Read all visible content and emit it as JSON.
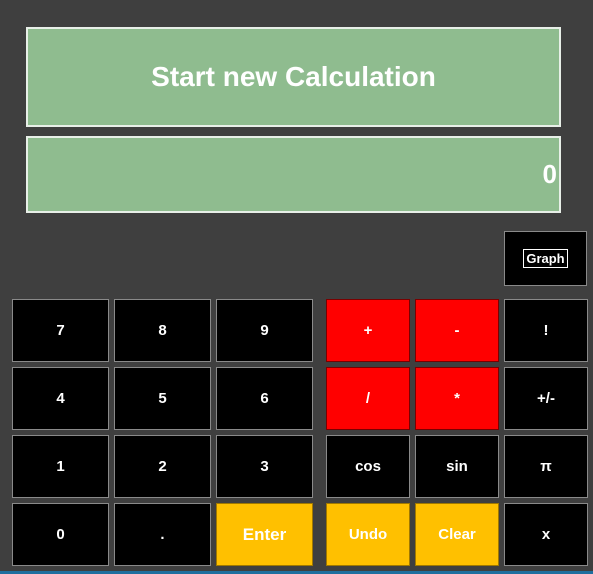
{
  "title": "Start new Calculation",
  "display_value": "0",
  "graph_button": {
    "label": "Graph"
  },
  "keys": {
    "seven": "7",
    "eight": "8",
    "nine": "9",
    "four": "4",
    "five": "5",
    "six": "6",
    "one": "1",
    "two": "2",
    "three": "3",
    "zero": "0",
    "dot": ".",
    "enter": "Enter",
    "plus": "+",
    "minus": "-",
    "factorial": "!",
    "divide": "/",
    "multiply": "*",
    "sign": "+/-",
    "cos": "cos",
    "sin": "sin",
    "pi": "π",
    "undo": "Undo",
    "clear": "Clear",
    "x": "x"
  },
  "colors": {
    "background": "#3f3f3f",
    "panel": "#8fbc8f",
    "operator": "#ff0000",
    "action": "#ffc000",
    "key": "#000000"
  }
}
